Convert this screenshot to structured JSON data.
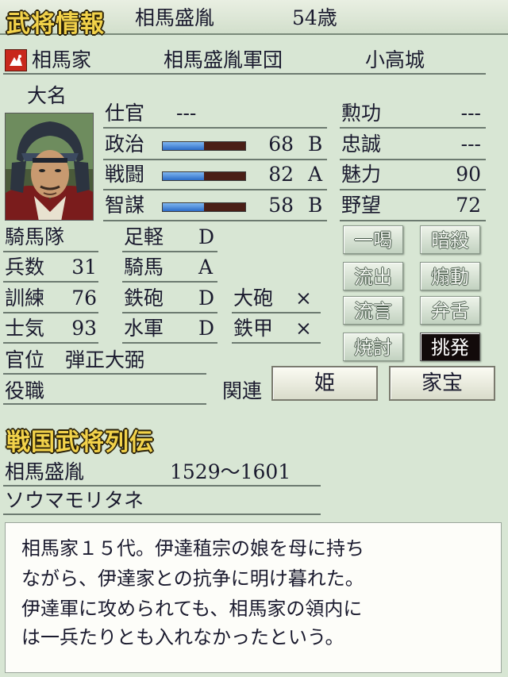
{
  "header": {
    "title": "武将情報",
    "name": "相馬盛胤",
    "age": "54歳"
  },
  "affiliation": {
    "clan": "相馬家",
    "corps": "相馬盛胤軍団",
    "castle": "小高城"
  },
  "rank": "大名",
  "service": {
    "label": "仕官",
    "value": "---"
  },
  "stats": [
    {
      "label": "政治",
      "value": "68",
      "grade": "B",
      "fraction": 0.5
    },
    {
      "label": "戦闘",
      "value": "82",
      "grade": "A",
      "fraction": 0.5
    },
    {
      "label": "智謀",
      "value": "58",
      "grade": "B",
      "fraction": 0.5
    }
  ],
  "right_stats": [
    {
      "label": "勲功",
      "value": "---"
    },
    {
      "label": "忠誠",
      "value": "---"
    },
    {
      "label": "魅力",
      "value": "90"
    },
    {
      "label": "野望",
      "value": "72"
    }
  ],
  "unit": {
    "label": "騎馬隊"
  },
  "troops": [
    {
      "label": "兵数",
      "value": "31"
    },
    {
      "label": "訓練",
      "value": "76"
    },
    {
      "label": "士気",
      "value": "93"
    }
  ],
  "aptitudes": [
    {
      "label": "足軽",
      "grade": "D"
    },
    {
      "label": "騎馬",
      "grade": "A"
    },
    {
      "label": "鉄砲",
      "grade": "D"
    },
    {
      "label": "水軍",
      "grade": "D"
    }
  ],
  "equipment": [
    {
      "label": "大砲",
      "value": "×"
    },
    {
      "label": "鉄甲",
      "value": "×"
    }
  ],
  "rank_title": {
    "label": "官位",
    "value": "弾正大弼"
  },
  "post": {
    "label": "役職"
  },
  "actions": [
    "一喝",
    "暗殺",
    "流出",
    "煽動",
    "流言",
    "弁舌",
    "焼討",
    "挑発"
  ],
  "related": {
    "label": "関連",
    "buttons": [
      "姫",
      "家宝"
    ]
  },
  "biography": {
    "title": "戦国武将列伝",
    "name": "相馬盛胤",
    "years": "1529〜1601",
    "kana": "ソウマモリタネ",
    "lines": [
      "相馬家１５代。伊達稙宗の娘を母に持ち",
      "ながら、伊達家との抗争に明け暮れた。",
      "伊達軍に攻められても、相馬家の領内に",
      "は一兵たりとも入れなかったという。"
    ]
  },
  "colors": {
    "gold": "#f2d24a",
    "bar_fill": "#2c6cc8",
    "bar_empty": "#4a1f16",
    "active_button": "#120a0a"
  }
}
